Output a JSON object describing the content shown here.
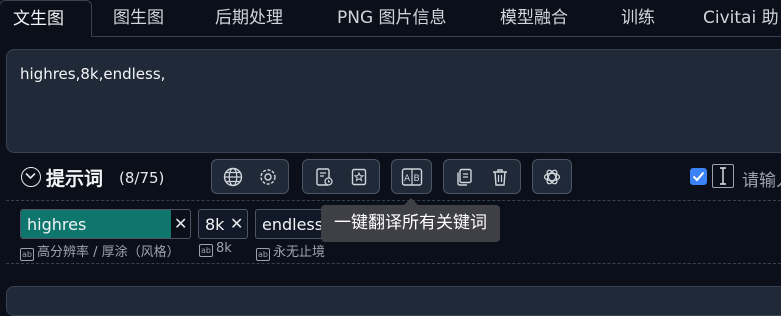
{
  "tabs": [
    {
      "label": "文生图",
      "active": true
    },
    {
      "label": "图生图"
    },
    {
      "label": "后期处理"
    },
    {
      "label": "PNG 图片信息"
    },
    {
      "label": "模型融合"
    },
    {
      "label": "训练"
    },
    {
      "label": "Civitai 助"
    }
  ],
  "prompt": {
    "value": "highres,8k,endless,"
  },
  "prompt_panel": {
    "title": "提示词",
    "count": "(8/75)",
    "input_hint": "请输入"
  },
  "tags": [
    {
      "text": "highres",
      "translation": "高分辨率 / 厚涂（风格）",
      "selected": true
    },
    {
      "text": "8k",
      "translation": "8k"
    },
    {
      "text": "endless",
      "translation": "永无止境"
    }
  ],
  "tooltip": {
    "text": "一键翻译所有关键词"
  },
  "colors": {
    "accent": "#0f766e",
    "checkbox": "#3b82f6",
    "background": "#0b0f19"
  }
}
